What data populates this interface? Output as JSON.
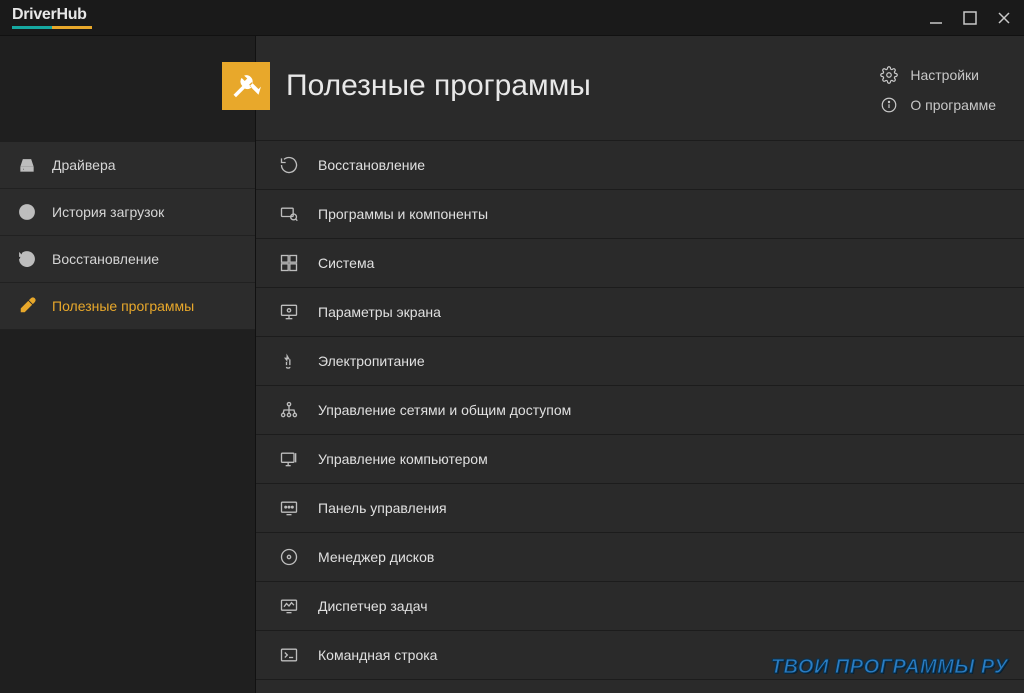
{
  "app": {
    "name": "DriverHub"
  },
  "colors": {
    "accent_teal": "#16a8a0",
    "accent_amber": "#e8a82b"
  },
  "header": {
    "title": "Полезные программы",
    "links": {
      "settings": "Настройки",
      "about": "О программе"
    }
  },
  "sidebar": {
    "items": [
      {
        "id": "drivers",
        "label": "Драйвера"
      },
      {
        "id": "history",
        "label": "История загрузок"
      },
      {
        "id": "restore",
        "label": "Восстановление"
      },
      {
        "id": "tools",
        "label": "Полезные программы"
      }
    ],
    "active": "tools"
  },
  "tools": [
    {
      "id": "restore",
      "label": "Восстановление"
    },
    {
      "id": "programs",
      "label": "Программы и компоненты"
    },
    {
      "id": "system",
      "label": "Система"
    },
    {
      "id": "display",
      "label": "Параметры экрана"
    },
    {
      "id": "power",
      "label": "Электропитание"
    },
    {
      "id": "network",
      "label": "Управление сетями и общим доступом"
    },
    {
      "id": "computer-mgmt",
      "label": "Управление компьютером"
    },
    {
      "id": "control-panel",
      "label": "Панель управления"
    },
    {
      "id": "disk-manager",
      "label": "Менеджер дисков"
    },
    {
      "id": "task-manager",
      "label": "Диспетчер задач"
    },
    {
      "id": "cmd",
      "label": "Командная строка"
    }
  ],
  "watermark": "ТВОИ ПРОГРАММЫ РУ"
}
